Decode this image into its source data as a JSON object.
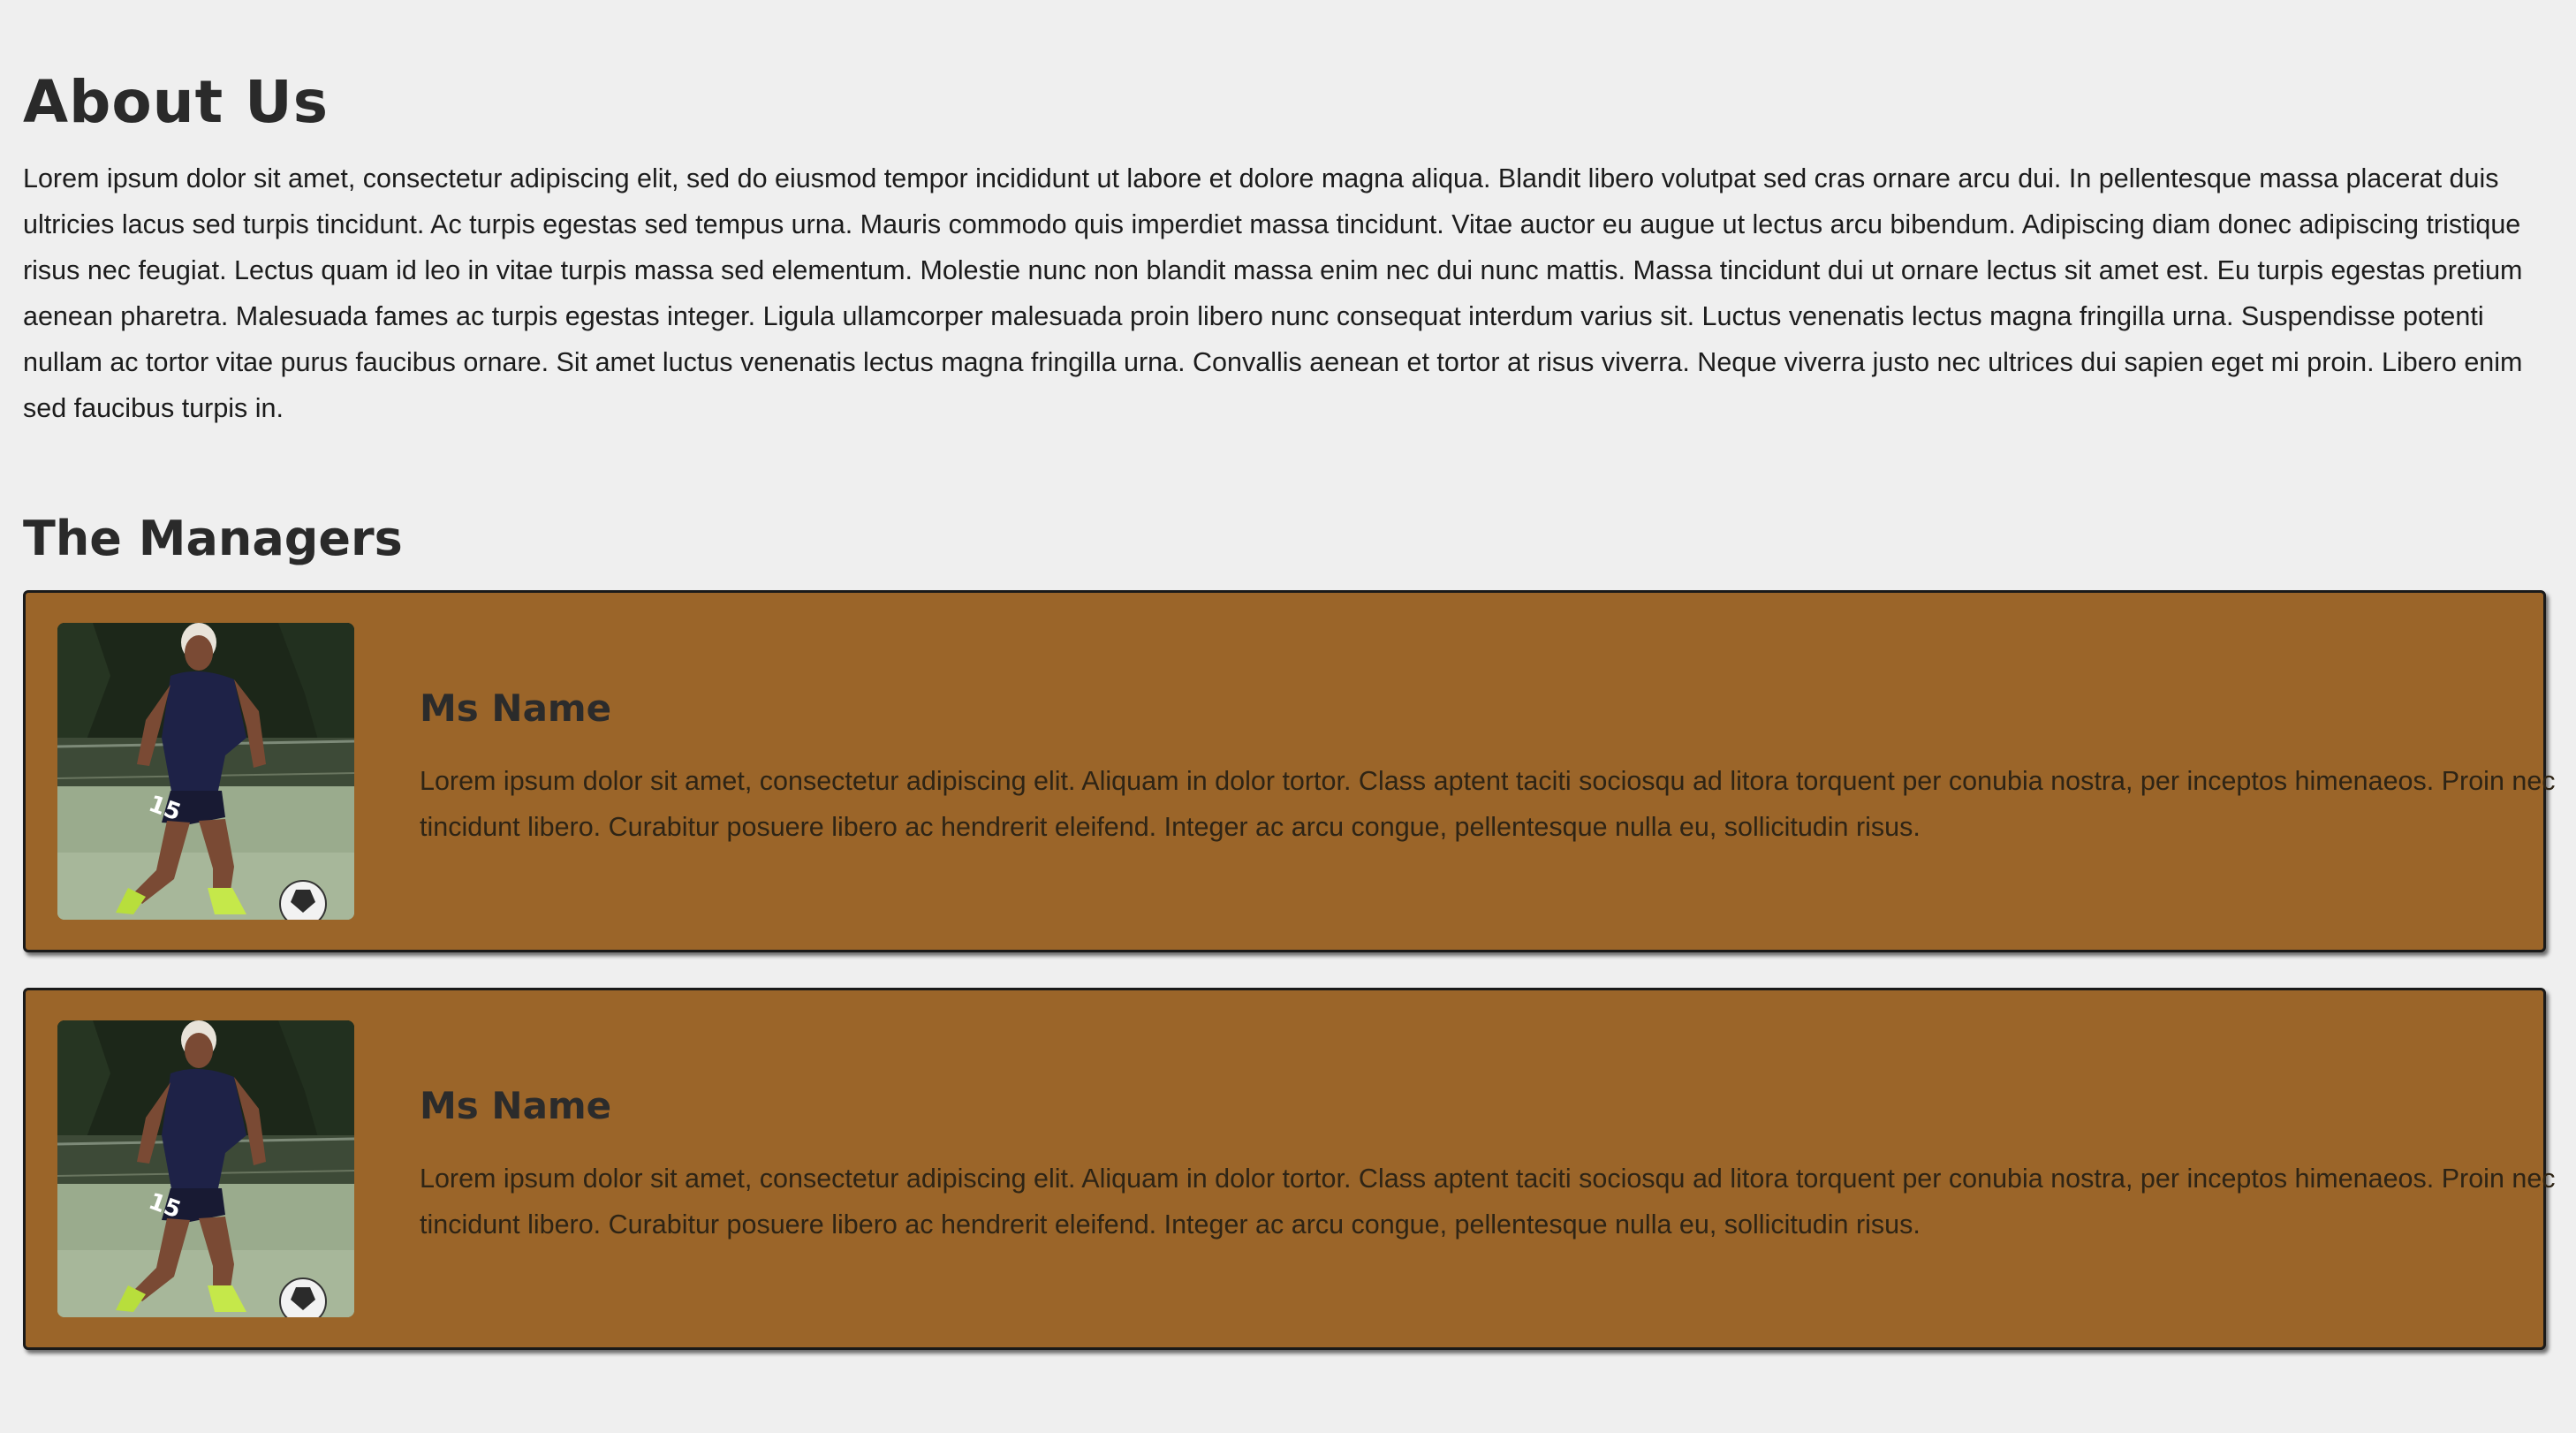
{
  "about": {
    "title": "About Us",
    "body": "Lorem ipsum dolor sit amet, consectetur adipiscing elit, sed do eiusmod tempor incididunt ut labore et dolore magna aliqua. Blandit libero volutpat sed cras ornare arcu dui. In pellentesque massa placerat duis ultricies lacus sed turpis tincidunt. Ac turpis egestas sed tempus urna. Mauris commodo quis imperdiet massa tincidunt. Vitae auctor eu augue ut lectus arcu bibendum. Adipiscing diam donec adipiscing tristique risus nec feugiat. Lectus quam id leo in vitae turpis massa sed elementum. Molestie nunc non blandit massa enim nec dui nunc mattis. Massa tincidunt dui ut ornare lectus sit amet est. Eu turpis egestas pretium aenean pharetra. Malesuada fames ac turpis egestas integer. Ligula ullamcorper malesuada proin libero nunc consequat interdum varius sit. Luctus venenatis lectus magna fringilla urna. Suspendisse potenti nullam ac tortor vitae purus faucibus ornare. Sit amet luctus venenatis lectus magna fringilla urna. Convallis aenean et tortor at risus viverra. Neque viverra justo nec ultrices dui sapien eget mi proin. Libero enim sed faucibus turpis in."
  },
  "managers": {
    "title": "The Managers",
    "cards": [
      {
        "name": "Ms Name",
        "text": "Lorem ipsum dolor sit amet, consectetur adipiscing elit. Aliquam in dolor tortor. Class aptent taciti sociosqu ad litora torquent per conubia nostra, per inceptos himenaeos. Proin nec tincidunt libero. Curabitur posuere libero ac hendrerit eleifend. Integer ac arcu congue, pellentesque nulla eu, sollicitudin risus.",
        "jersey_number": "15"
      },
      {
        "name": "Ms Name",
        "text": "Lorem ipsum dolor sit amet, consectetur adipiscing elit. Aliquam in dolor tortor. Class aptent taciti sociosqu ad litora torquent per conubia nostra, per inceptos himenaeos. Proin nec tincidunt libero. Curabitur posuere libero ac hendrerit eleifend. Integer ac arcu congue, pellentesque nulla eu, sollicitudin risus.",
        "jersey_number": "15"
      }
    ]
  },
  "colors": {
    "background": "#efefef",
    "card": "#9b6529",
    "heading": "#2a2a2a"
  }
}
